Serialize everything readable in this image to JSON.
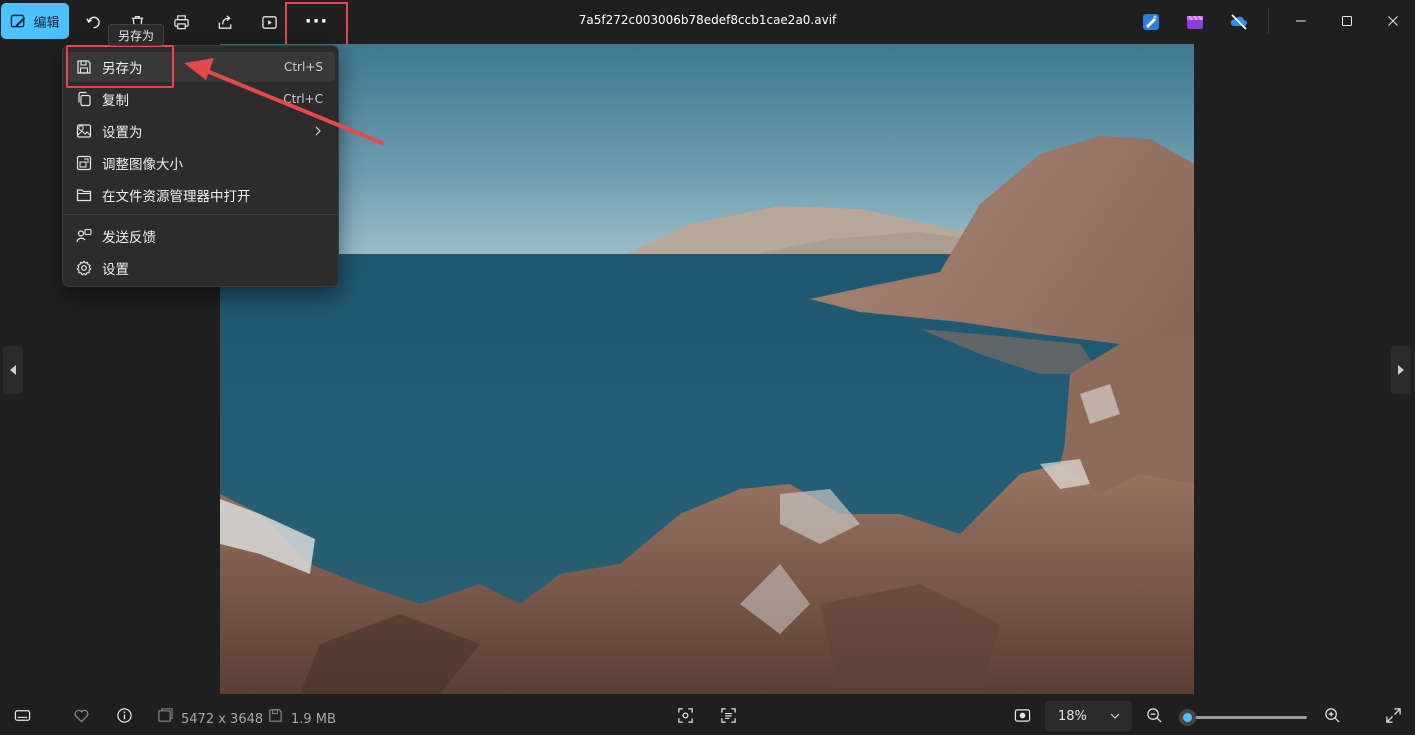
{
  "toolbar": {
    "edit_label": "编辑",
    "more_label": "···",
    "tooltip": "另存为"
  },
  "window": {
    "title": "7a5f272c003006b78edef8ccb1cae2a0.avif"
  },
  "menu": {
    "items": [
      {
        "label": "另存为",
        "shortcut": "Ctrl+S",
        "icon": "save-icon"
      },
      {
        "label": "复制",
        "shortcut": "Ctrl+C",
        "icon": "copy-icon"
      },
      {
        "label": "设置为",
        "shortcut": "",
        "icon": "set-as-icon"
      },
      {
        "label": "调整图像大小",
        "shortcut": "",
        "icon": "resize-icon"
      },
      {
        "label": "在文件资源管理器中打开",
        "shortcut": "",
        "icon": "folder-icon"
      },
      {
        "label": "发送反馈",
        "shortcut": "",
        "icon": "feedback-icon"
      },
      {
        "label": "设置",
        "shortcut": "",
        "icon": "gear-icon"
      }
    ]
  },
  "status": {
    "dimensions": "5472 x 3648",
    "filesize": "1.9 MB",
    "zoom": "18%",
    "zoom_level": 0.02
  },
  "colors": {
    "accent": "#4cc2ff",
    "annotation": "#e5484d",
    "background": "#1f1f1f"
  }
}
